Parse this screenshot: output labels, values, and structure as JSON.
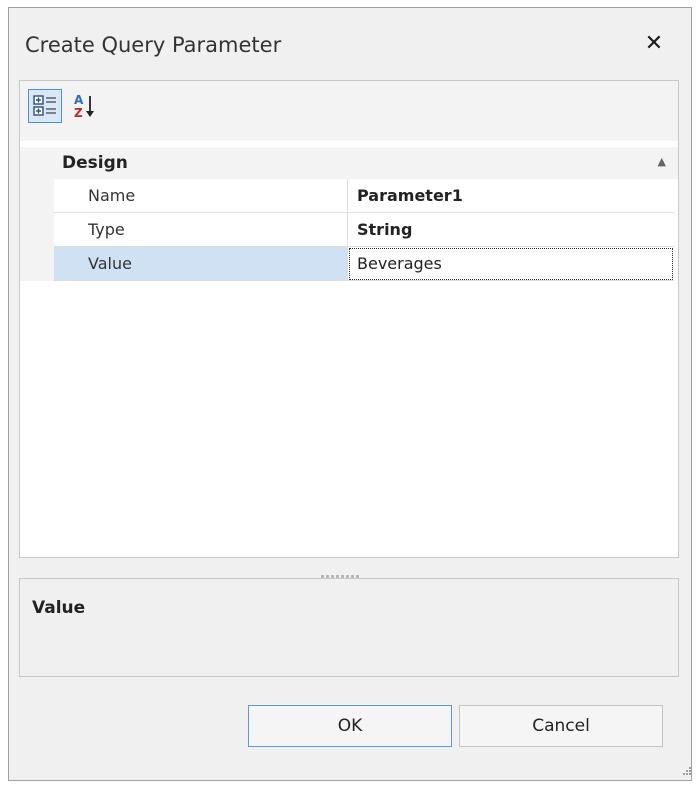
{
  "dialog": {
    "title": "Create Query Parameter",
    "close_glyph": "✕"
  },
  "toolbar": {
    "categorized_icon": "categorized-view-icon",
    "alphabetical_icon": "sort-alphabetical-icon"
  },
  "property_grid": {
    "category": "Design",
    "collapse_glyph": "▲",
    "rows": [
      {
        "name": "Name",
        "value": "Parameter1"
      },
      {
        "name": "Type",
        "value": "String"
      },
      {
        "name": "Value",
        "value": "Beverages"
      }
    ]
  },
  "description": {
    "title": "Value"
  },
  "buttons": {
    "ok": "OK",
    "cancel": "Cancel"
  },
  "colors": {
    "selected_row": "#cfe1f3",
    "accent_border": "#5b9ad6"
  }
}
